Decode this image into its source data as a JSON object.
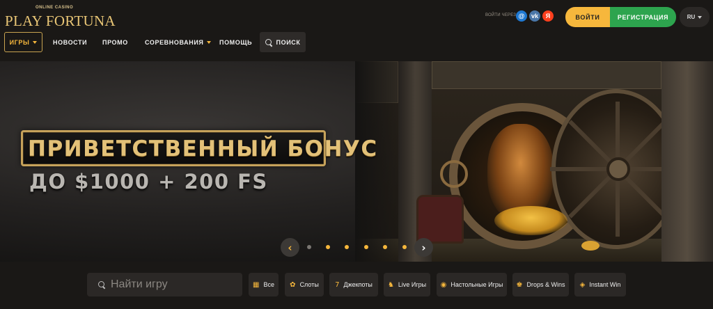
{
  "logo": {
    "subtitle": "ONLINE CASINO",
    "brand": "PLAY FORTUNA"
  },
  "header": {
    "social_label": "ВОЙТИ ЧЕРЕЗ:",
    "social": [
      {
        "name": "mail-ru-icon",
        "glyph": "@"
      },
      {
        "name": "vk-icon",
        "glyph": "vk"
      },
      {
        "name": "yandex-icon",
        "glyph": "Я"
      }
    ],
    "login_label": "ВОЙТИ",
    "register_label": "РЕГИСТРАЦИЯ",
    "language": "RU"
  },
  "nav": {
    "items": [
      {
        "label": "ИГРЫ",
        "dropdown": true,
        "active": true
      },
      {
        "label": "НОВОСТИ"
      },
      {
        "label": "ПРОМО"
      },
      {
        "label": "СОРЕВНОВАНИЯ",
        "dropdown": true
      },
      {
        "label": "ПОМОЩЬ"
      }
    ],
    "search_label": "ПОИСК"
  },
  "banner": {
    "title": "ПРИВЕТСТВЕННЫЙ БОНУС",
    "subtitle": "ДО $1000 + 200 FS",
    "prev_glyph": "‹",
    "next_glyph": "›",
    "slides_total": 6,
    "active_slide": 1
  },
  "filters": {
    "search_placeholder": "Найти игру",
    "categories": [
      {
        "label": "Все",
        "icon": "grid-icon",
        "glyph": "▦"
      },
      {
        "label": "Слоты",
        "icon": "slots-icon",
        "glyph": "✿"
      },
      {
        "label": "Джекпоты",
        "icon": "jackpot-icon",
        "glyph": "7"
      },
      {
        "label": "Live Игры",
        "icon": "live-games-icon",
        "glyph": "♞"
      },
      {
        "label": "Настольные Игры",
        "icon": "table-games-icon",
        "glyph": "◉"
      },
      {
        "label": "Drops & Wins",
        "icon": "drops-wins-icon",
        "glyph": "♚"
      },
      {
        "label": "Instant Win",
        "icon": "instant-win-icon",
        "glyph": "◈"
      }
    ]
  },
  "colors": {
    "accent": "#f6b73c",
    "register": "#2da44e",
    "background": "#1a1816",
    "gold_text": "#e3c178"
  }
}
